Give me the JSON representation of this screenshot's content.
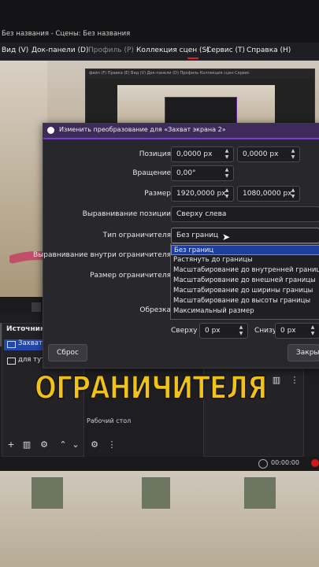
{
  "window": {
    "title": "Без названия - Сцены: Без названия"
  },
  "menu": [
    {
      "label": "Вид (V)"
    },
    {
      "label": "Док-панели (D)"
    },
    {
      "label": "Профиль (P)"
    },
    {
      "label": "Коллекция сцен (S)"
    },
    {
      "label": "Сервис (T)"
    },
    {
      "label": "Справка (H)"
    }
  ],
  "nested_preview": {
    "menu_text": "файл (F)   Правка (E)   Вид (V)   Док-панели (D)   Профиль   Коллекция сцен   Сервис"
  },
  "dialog": {
    "title": "Изменить преобразование для «Захват экрана 2»",
    "position_label": "Позиция",
    "position_x": "0,0000 px",
    "position_y": "0,0000 px",
    "rotation_label": "Вращение",
    "rotation": "0,00°",
    "size_label": "Размер",
    "size_w": "1920,0000 px",
    "size_h": "1080,0000 px",
    "alignment_label": "Выравнивание позиции",
    "alignment_value": "Сверху слева",
    "bounds_type_label": "Тип ограничителя",
    "bounds_type_value": "Без границ",
    "bounds_align_label": "Выравнивание внутри ограничителя",
    "bounds_size_label": "Размер ограничителя",
    "crop_label": "Обрезка",
    "crop_top_label": "Сверху",
    "crop_top": "0 px",
    "crop_bottom_label": "Снизу",
    "crop_bottom": "0 px",
    "reset_label": "Сброс",
    "close_label": "Закрыть"
  },
  "dropdown_options": [
    {
      "label": "Без границ"
    },
    {
      "label": "Растянуть до границы"
    },
    {
      "label": "Масштабирование до внутренней границы"
    },
    {
      "label": "Масштабирование до внешней границы"
    },
    {
      "label": "Масштабирование до ширины границы"
    },
    {
      "label": "Масштабирование до высоты границы"
    },
    {
      "label": "Максимальный размер"
    }
  ],
  "sources": {
    "header": "Источники",
    "items": [
      {
        "label": "Захват"
      },
      {
        "label": "для туто"
      }
    ]
  },
  "mixer": {
    "desktop_label": "Рабочий стол",
    "time": "00:00:00"
  },
  "overlay_caption": "ОГРАНИЧИТЕЛЯ",
  "colors": {
    "accent": "#7a3fd0",
    "caption": "#f2c21b",
    "selected": "#1f3fa0",
    "arrow": "#c0506a"
  }
}
